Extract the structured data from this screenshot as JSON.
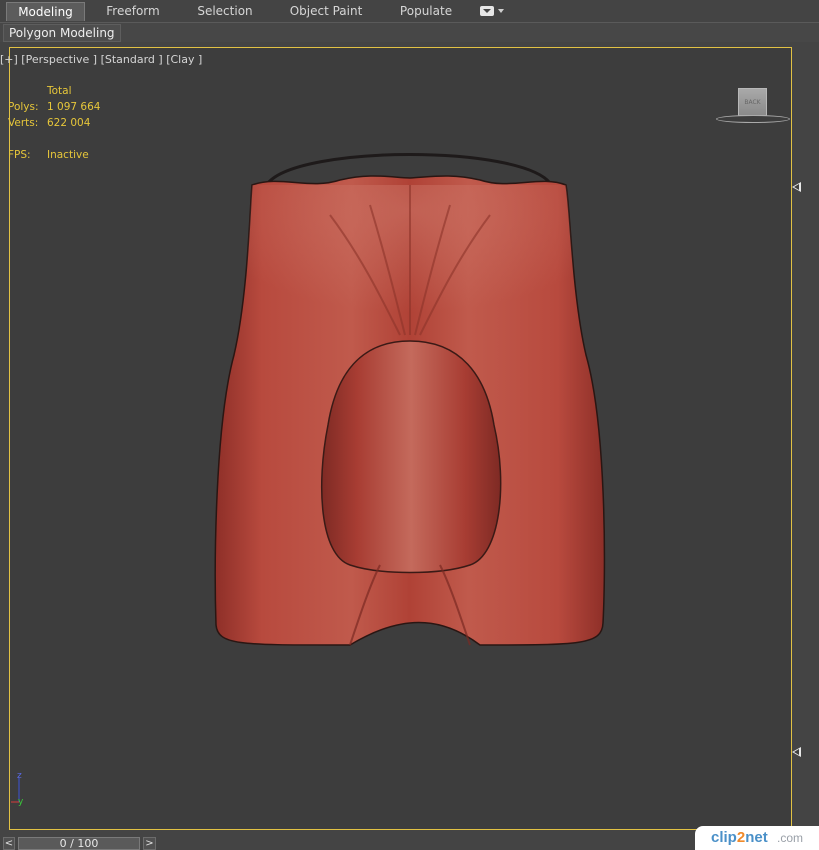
{
  "ribbon": {
    "tabs": [
      {
        "label": "Modeling",
        "active": true
      },
      {
        "label": "Freeform",
        "active": false
      },
      {
        "label": "Selection",
        "active": false
      },
      {
        "label": "Object Paint",
        "active": false
      },
      {
        "label": "Populate",
        "active": false
      }
    ],
    "dropdown_icon": "chevron-down-icon",
    "panel_label": "Polygon Modeling"
  },
  "viewport": {
    "label": "[+] [Perspective ] [Standard ] [Clay ]",
    "border_color": "#e2c244",
    "background": "#3d3d3d",
    "stats": {
      "header": "Total",
      "polys_label": "Polys:",
      "polys_value": "1 097 664",
      "verts_label": "Verts:",
      "verts_value": "622 004",
      "fps_label": "FPS:",
      "fps_value": "Inactive",
      "color": "#e6c63a"
    },
    "viewcube_label": "BACK",
    "model_color": "#b4463a"
  },
  "axis": {
    "z": "z",
    "y": "y"
  },
  "timeline": {
    "prev": "<",
    "position": "0 / 100",
    "next": ">"
  },
  "watermark": {
    "brand": "clip",
    "brand_mid": "2",
    "brand_end": "net",
    "suffix": ".com"
  }
}
